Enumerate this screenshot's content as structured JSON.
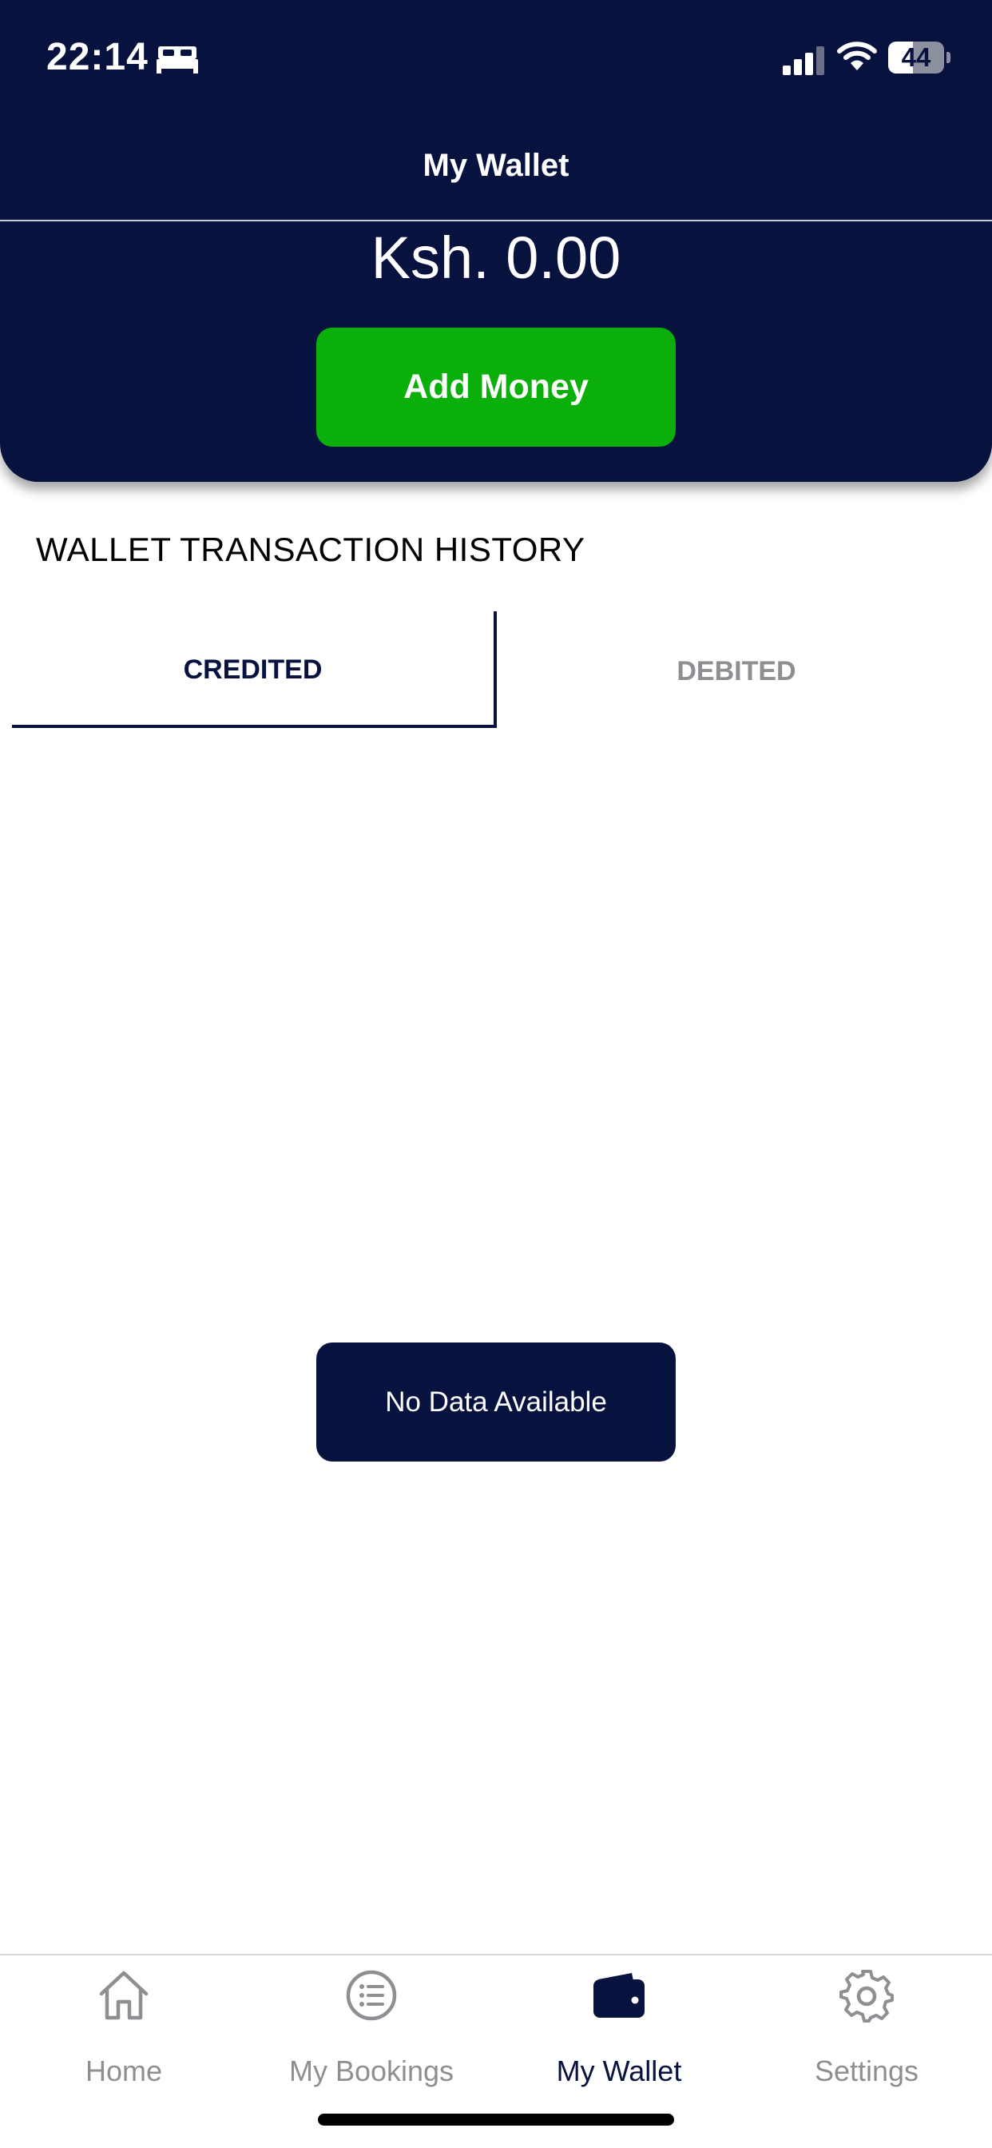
{
  "status_bar": {
    "time": "22:14",
    "battery_level": "44",
    "icons": [
      "bed-icon",
      "signal-icon",
      "wifi-icon",
      "battery-icon"
    ]
  },
  "header": {
    "title": "My Wallet",
    "balance": "Ksh. 0.00",
    "add_money_label": "Add Money"
  },
  "history": {
    "title": "WALLET TRANSACTION HISTORY",
    "tabs": [
      {
        "label": "CREDITED",
        "active": true
      },
      {
        "label": "DEBITED",
        "active": false
      }
    ],
    "empty_message": "No Data Available"
  },
  "tab_bar": {
    "items": [
      {
        "label": "Home",
        "icon": "home-icon",
        "active": false
      },
      {
        "label": "My Bookings",
        "icon": "list-icon",
        "active": false
      },
      {
        "label": "My Wallet",
        "icon": "wallet-icon",
        "active": true
      },
      {
        "label": "Settings",
        "icon": "gear-icon",
        "active": false
      }
    ]
  },
  "colors": {
    "primary_navy": "#08123f",
    "accent_green": "#0aaf0a",
    "inactive_gray": "#8e8e93",
    "background": "#ffffff"
  }
}
